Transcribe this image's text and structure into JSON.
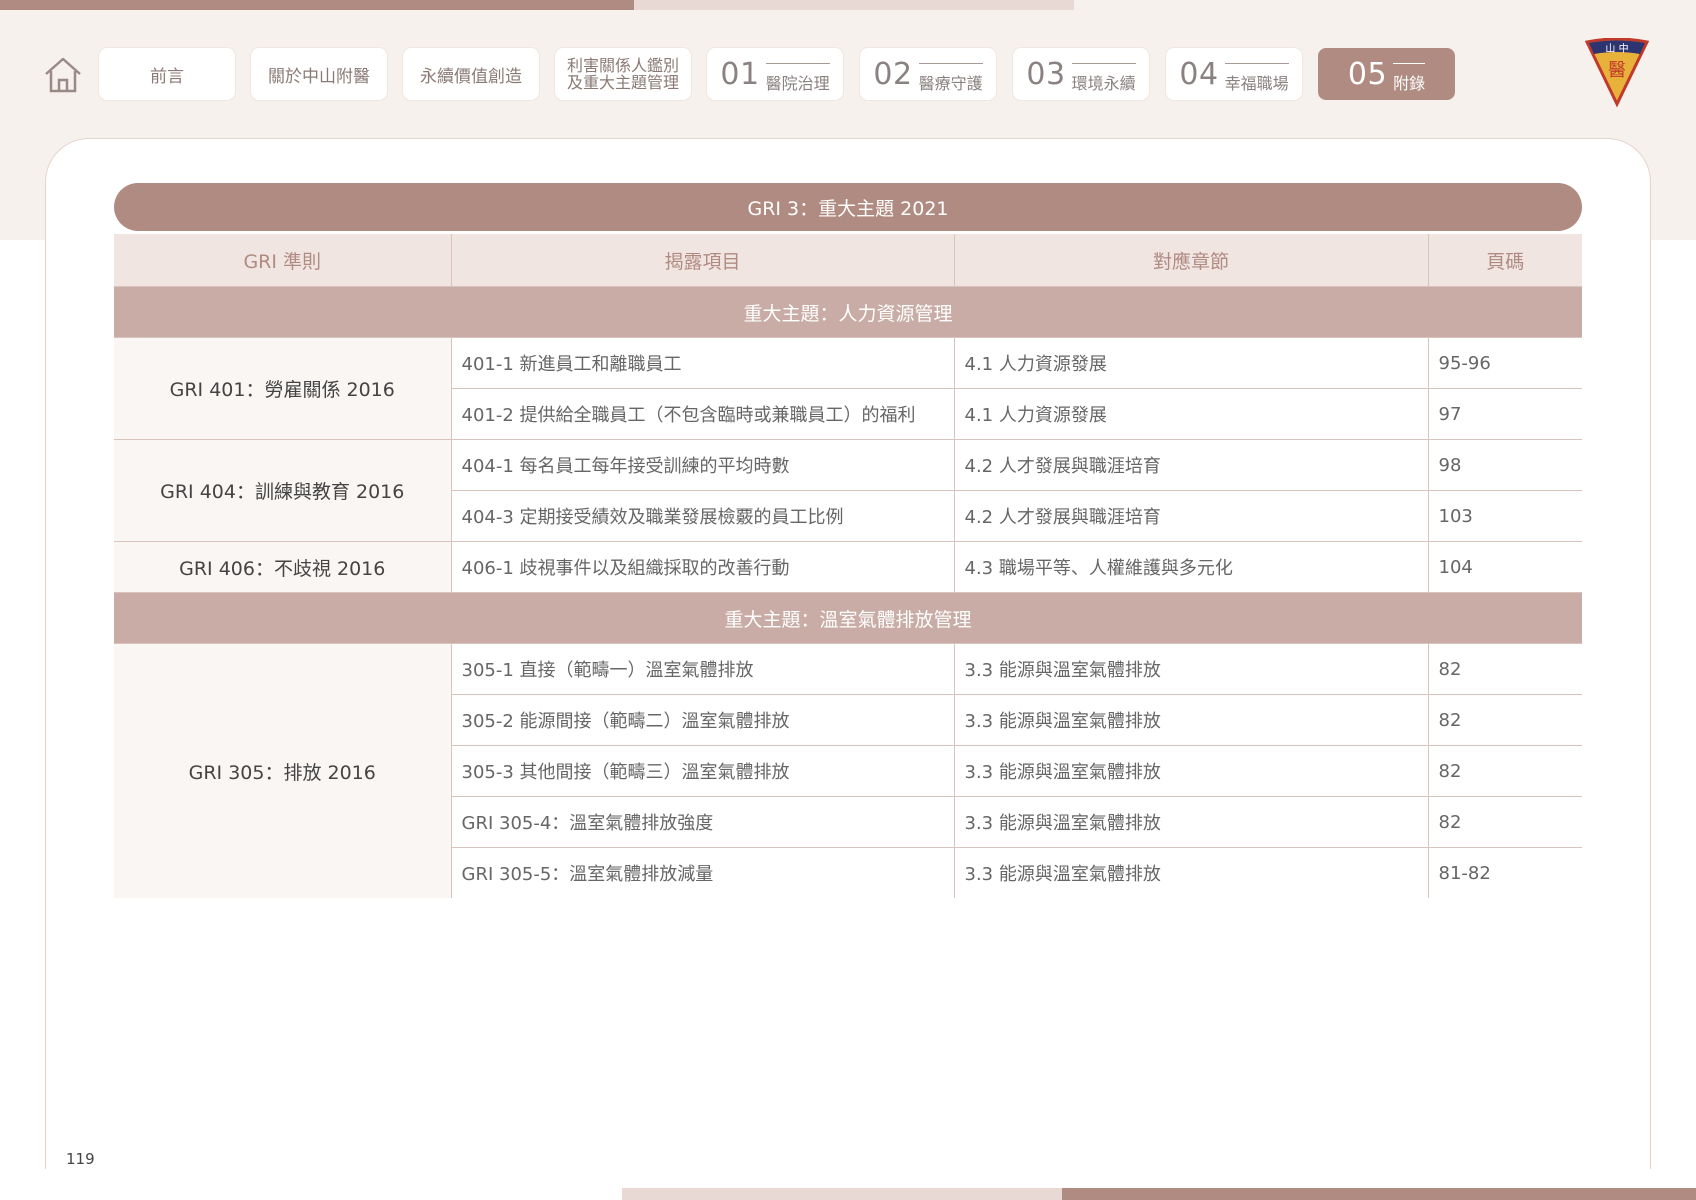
{
  "nav": {
    "items": [
      {
        "label": "前言"
      },
      {
        "label": "關於中山附醫"
      },
      {
        "label": "永續價值創造"
      },
      {
        "label_line1": "利害關係人鑑別",
        "label_line2": "及重大主題管理"
      },
      {
        "num": "01",
        "label": "醫院治理"
      },
      {
        "num": "02",
        "label": "醫療守護"
      },
      {
        "num": "03",
        "label": "環境永續"
      },
      {
        "num": "04",
        "label": "幸福職場"
      },
      {
        "num": "05",
        "label": "附錄"
      }
    ]
  },
  "logo": {
    "text_top": "山 中",
    "text_main": "醫"
  },
  "table": {
    "title": "GRI 3：重大主題 2021",
    "headers": [
      "GRI 準則",
      "揭露項目",
      "對應章節",
      "頁碼"
    ],
    "sections": [
      {
        "title": "重大主題：人力資源管理",
        "groups": [
          {
            "standard": "GRI 401：勞雇關係 2016",
            "rows": [
              {
                "item": "401-1 新進員工和離職員工",
                "chapter": "4.1 人力資源發展",
                "page": "95-96"
              },
              {
                "item": "401-2 提供給全職員工（不包含臨時或兼職員工）的福利",
                "chapter": "4.1 人力資源發展",
                "page": "97"
              }
            ]
          },
          {
            "standard": "GRI 404：訓練與教育 2016",
            "rows": [
              {
                "item": "404-1 每名員工每年接受訓練的平均時數",
                "chapter": "4.2 人才發展與職涯培育",
                "page": "98"
              },
              {
                "item": "404-3 定期接受績效及職業發展檢覈的員工比例",
                "chapter": "4.2 人才發展與職涯培育",
                "page": "103"
              }
            ]
          },
          {
            "standard": "GRI 406：不歧視 2016",
            "rows": [
              {
                "item": "406-1 歧視事件以及組織採取的改善行動",
                "chapter": "4.3 職場平等、人權維護與多元化",
                "page": "104"
              }
            ]
          }
        ]
      },
      {
        "title": "重大主題：溫室氣體排放管理",
        "groups": [
          {
            "standard": "GRI 305：排放 2016",
            "rows": [
              {
                "item": "305-1 直接（範疇一）溫室氣體排放",
                "chapter": "3.3 能源與溫室氣體排放",
                "page": "82"
              },
              {
                "item": "305-2 能源間接（範疇二）溫室氣體排放",
                "chapter": "3.3 能源與溫室氣體排放",
                "page": "82"
              },
              {
                "item": "305-3 其他間接（範疇三）溫室氣體排放",
                "chapter": "3.3 能源與溫室氣體排放",
                "page": "82"
              },
              {
                "item": "GRI 305-4：溫室氣體排放強度",
                "chapter": "3.3 能源與溫室氣體排放",
                "page": "82"
              },
              {
                "item": "GRI 305-5：溫室氣體排放減量",
                "chapter": "3.3 能源與溫室氣體排放",
                "page": "81-82"
              }
            ]
          }
        ]
      }
    ]
  },
  "page_number": "119",
  "colors": {
    "accent": "#b08b82",
    "section": "#c8aca5",
    "header_bg": "#f1e5e2",
    "band": "#f7f1ee"
  }
}
